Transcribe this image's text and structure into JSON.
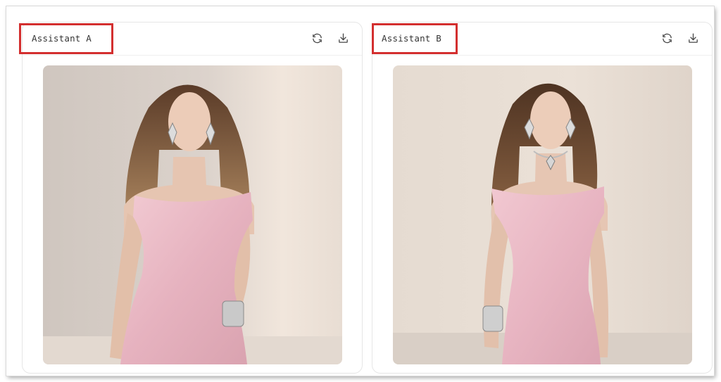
{
  "panels": [
    {
      "title": "Assistant A",
      "actions": [
        {
          "icon": "refresh-icon"
        },
        {
          "icon": "download-icon"
        }
      ],
      "image": {
        "subject": "woman in pink satin off-shoulder dress with diamond earrings and silver cuff bracelet"
      }
    },
    {
      "title": "Assistant B",
      "actions": [
        {
          "icon": "refresh-icon"
        },
        {
          "icon": "download-icon"
        }
      ],
      "image": {
        "subject": "woman in pink satin off-shoulder dress with diamond earrings, pendant necklace and silver cuff bracelet"
      }
    }
  ],
  "colors": {
    "highlight": "#d32f2f",
    "dress": "#e9b9c4",
    "background_a": "#d8d0c9",
    "background_b": "#e6dcd2"
  }
}
